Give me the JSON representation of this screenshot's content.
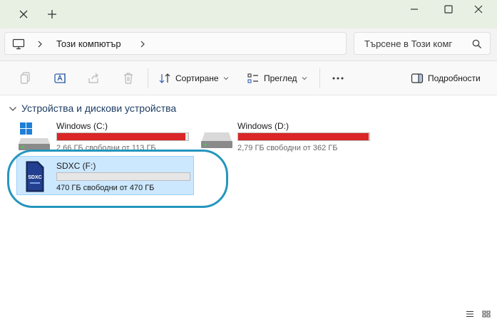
{
  "breadcrumb": {
    "location": "Този компютър"
  },
  "search": {
    "placeholder": "Търсене в Този комг"
  },
  "toolbar": {
    "sort_label": "Сортиране",
    "view_label": "Преглед",
    "details_label": "Подробности"
  },
  "group": {
    "title": "Устройства и дискови устройства"
  },
  "drives": [
    {
      "name": "Windows (C:)",
      "free_text": "2,66 ГБ свободни от 113 ГБ",
      "used_fraction": 0.976,
      "bar_color": "#da2626"
    },
    {
      "name": "Windows  (D:)",
      "free_text": "2,79 ГБ свободни от 362 ГБ",
      "used_fraction": 0.992,
      "bar_color": "#da2626"
    },
    {
      "name": "SDXC (F:)",
      "free_text": "470 ГБ свободни от 470 ГБ",
      "used_fraction": 0.0,
      "bar_color": "#26a0da"
    }
  ],
  "sd_card_icon_text": "SDXC",
  "colors": {
    "accent_ring": "#2596be",
    "selection_bg": "#cce8ff",
    "titlebar_bg": "#e8f0e4"
  }
}
